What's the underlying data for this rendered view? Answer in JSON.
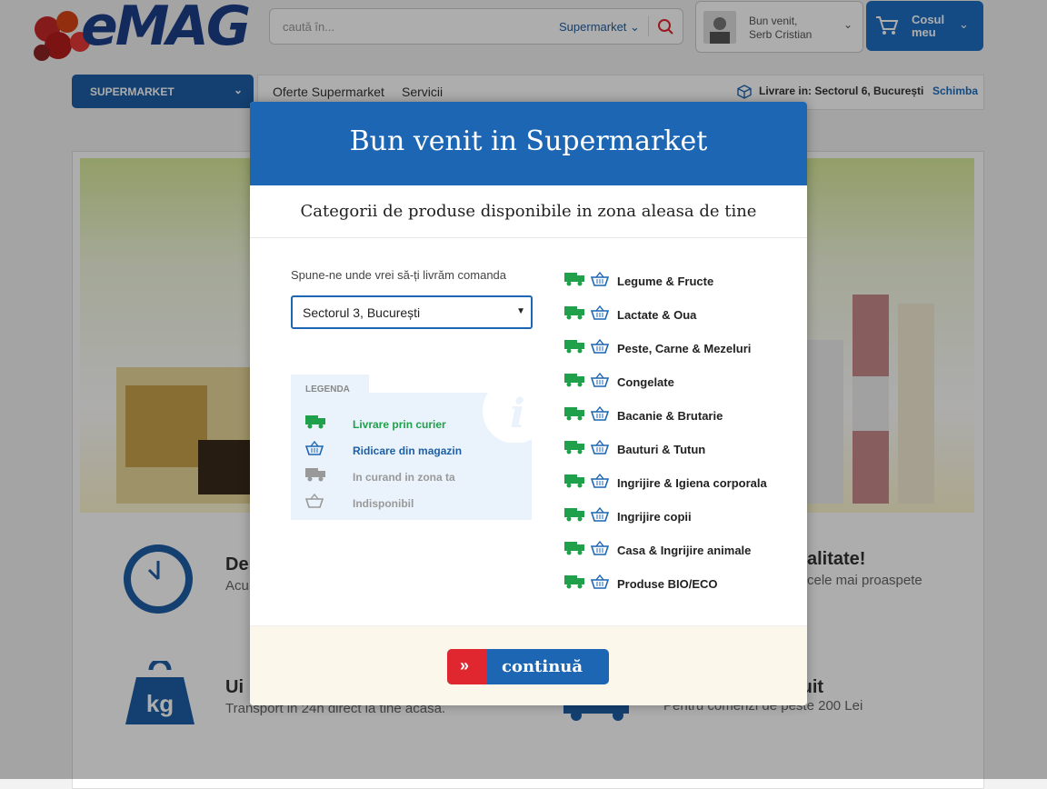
{
  "header": {
    "logo_text": "eMAG",
    "search_placeholder": "caută în...",
    "search_category": "Supermarket",
    "greeting": "Bun venit,",
    "user_name": "Serb Cristian",
    "cart_label_1": "Cosul",
    "cart_label_2": "meu"
  },
  "nav": {
    "supermarket": "SUPERMARKET",
    "links": [
      "Oferte Supermarket",
      "Servicii"
    ],
    "delivery": "Livrare in: Sectorul 6, București",
    "change": "Schimba"
  },
  "features": [
    {
      "title": "De",
      "sub": "Acu"
    },
    {
      "title": "alitate!",
      "sub": "cele mai proaspete"
    },
    {
      "title": "Ui",
      "sub": "Transport in 24h direct la tine acasa."
    },
    {
      "title": "tuit",
      "sub": "Pentru comenzi de peste 200 Lei"
    }
  ],
  "modal": {
    "title": "Bun venit in Supermarket",
    "subtitle": "Categorii de produse disponibile in zona aleasa de tine",
    "ask": "Spune-ne unde vrei să-ți livrăm comanda",
    "selected_location": "Sectorul 3, București",
    "legend_title": "LEGENDA",
    "legend": [
      {
        "label": "Livrare prin curier",
        "color": "#1fa04b"
      },
      {
        "label": "Ridicare din magazin",
        "color": "#1d66b3"
      },
      {
        "label": "In curand in zona ta",
        "color": "#999999"
      },
      {
        "label": "Indisponibil",
        "color": "#999999"
      }
    ],
    "categories": [
      "Legume & Fructe",
      "Lactate & Oua",
      "Peste, Carne & Mezeluri",
      "Congelate",
      "Bacanie & Brutarie",
      "Bauturi & Tutun",
      "Ingrijire & Igiena corporala",
      "Ingrijire copii",
      "Casa & Ingrijire animale",
      "Produse BIO/ECO"
    ],
    "continue": "continuă"
  },
  "colors": {
    "primary": "#1d66b3",
    "accent": "#e0262e",
    "green": "#1fa04b"
  }
}
